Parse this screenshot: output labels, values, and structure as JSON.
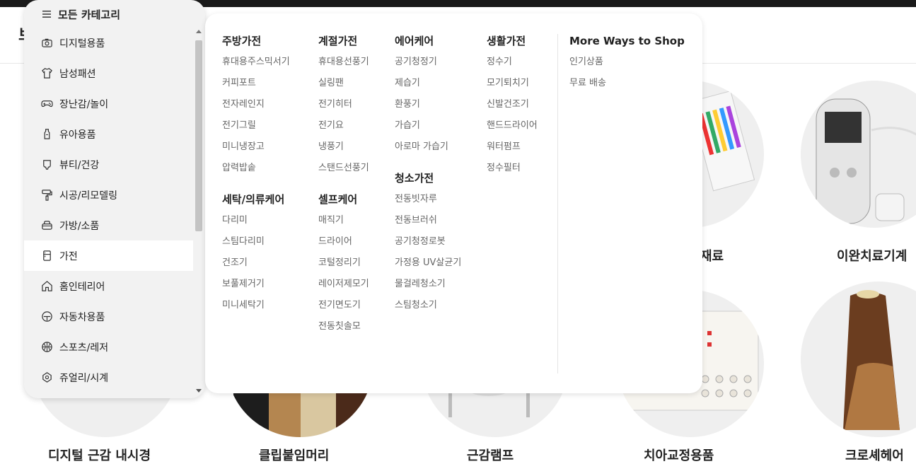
{
  "page": {
    "logo_fragment": "브"
  },
  "category_menu": {
    "title": "모든 카테고리",
    "items": [
      {
        "label": "디지털용품",
        "icon": "camera-icon"
      },
      {
        "label": "남성패션",
        "icon": "shirt-icon"
      },
      {
        "label": "장난감/놀이",
        "icon": "gamepad-icon"
      },
      {
        "label": "유아용품",
        "icon": "baby-bottle-icon"
      },
      {
        "label": "뷰티/건강",
        "icon": "beauty-icon"
      },
      {
        "label": "시공/리모델링",
        "icon": "paint-roller-icon"
      },
      {
        "label": "가방/소품",
        "icon": "bag-icon"
      },
      {
        "label": "가전",
        "icon": "appliance-icon",
        "active": true
      },
      {
        "label": "홈인테리어",
        "icon": "home-icon"
      },
      {
        "label": "자동차용품",
        "icon": "car-icon"
      },
      {
        "label": "스포츠/레저",
        "icon": "basketball-icon"
      },
      {
        "label": "쥬얼리/시계",
        "icon": "gem-icon"
      }
    ]
  },
  "mega_menu": {
    "kitchen": {
      "title": "주방가전",
      "items": [
        "휴대용주스믹서기",
        "커피포트",
        "전자레인지",
        "전기그릴",
        "미니냉장고",
        "압력밥솥"
      ]
    },
    "laundry": {
      "title": "세탁/의류케어",
      "items": [
        "다리미",
        "스팀다리미",
        "건조기",
        "보풀제거기",
        "미니세탁기"
      ]
    },
    "seasonal": {
      "title": "계절가전",
      "items": [
        "휴대용선풍기",
        "실링팬",
        "전기히터",
        "전기요",
        "냉풍기",
        "스탠드선풍기"
      ]
    },
    "selfcare": {
      "title": "셀프케어",
      "items": [
        "매직기",
        "드라이어",
        "코털정리기",
        "레이저제모기",
        "전기면도기",
        "전동칫솔모"
      ]
    },
    "aircare": {
      "title": "에어케어",
      "items": [
        "공기청정기",
        "제습기",
        "환풍기",
        "가습기",
        "아로마 가습기"
      ]
    },
    "cleaning": {
      "title": "청소가전",
      "items": [
        "전동빗자루",
        "전동브러쉬",
        "공기청정로봇",
        "가정용 UV살균기",
        "물걸레청소기",
        "스팀청소기"
      ]
    },
    "living": {
      "title": "생활가전",
      "items": [
        "정수기",
        "모기퇴치기",
        "신발건조기",
        "핸드드라이어",
        "워터펌프",
        "정수필터"
      ]
    },
    "more": {
      "title": "More Ways to Shop",
      "items": [
        "인기상품",
        "무료 배송"
      ]
    }
  },
  "background_products": {
    "labels": [
      "재료",
      "이완치료기계",
      "디지털 근감 내시경",
      "클립붙임머리",
      "근감램프",
      "치아교정용품",
      "크로셰헤어"
    ]
  },
  "colors": {
    "panel_bg": "#f2f2f2",
    "active_bg": "#ffffff",
    "link_gray": "#666666",
    "circle_bg": "#efefef"
  }
}
